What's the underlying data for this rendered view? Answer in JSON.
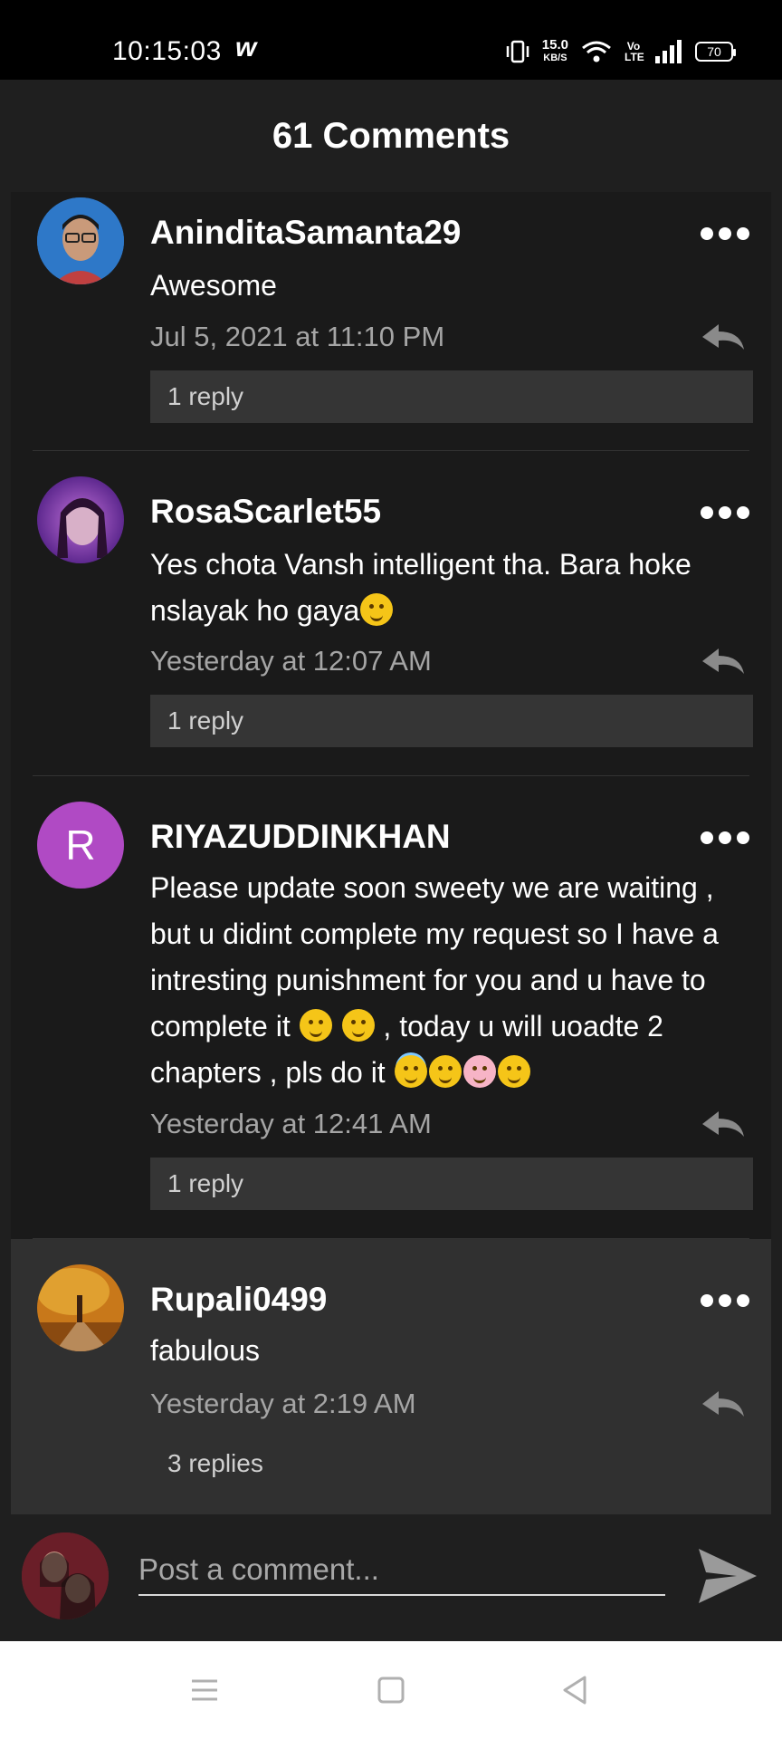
{
  "status_bar": {
    "time": "10:15:03",
    "app_badge": "w",
    "speed_value": "15.0",
    "speed_unit": "KB/S",
    "network": "Vo LTE",
    "battery": "70"
  },
  "header": {
    "title": "61 Comments"
  },
  "comments": [
    {
      "username": "AninditaSamanta29",
      "text": "Awesome",
      "date": "Jul 5, 2021 at 11:10 PM",
      "replies": "1 reply",
      "avatar_icon": "user-photo"
    },
    {
      "username": "RosaScarlet55",
      "text": "Yes chota Vansh intelligent tha. Bara hoke nslayak ho gaya",
      "date": "Yesterday at 12:07 AM",
      "replies": "1 reply",
      "avatar_icon": "user-photo"
    },
    {
      "username": "RIYAZUDDINKHAN",
      "avatar_letter": "R",
      "text_part1": "Please update soon sweety we are waiting , but u didint complete my request so I have a intresting punishment for you and u have to complete it ",
      "text_part2": " , today u will uoadte 2 chapters , pls do it ",
      "date": "Yesterday at 12:41 AM",
      "replies": "1 reply"
    },
    {
      "username": "Rupali0499",
      "text": "fabulous",
      "date": "Yesterday at 2:19 AM",
      "replies": "3 replies",
      "avatar_icon": "autumn-tree-photo"
    }
  ],
  "composer": {
    "placeholder": "Post a comment..."
  },
  "colors": {
    "background": "#1a1a1a",
    "highlight": "#303030",
    "accent_avatar": "#b04ac4"
  }
}
